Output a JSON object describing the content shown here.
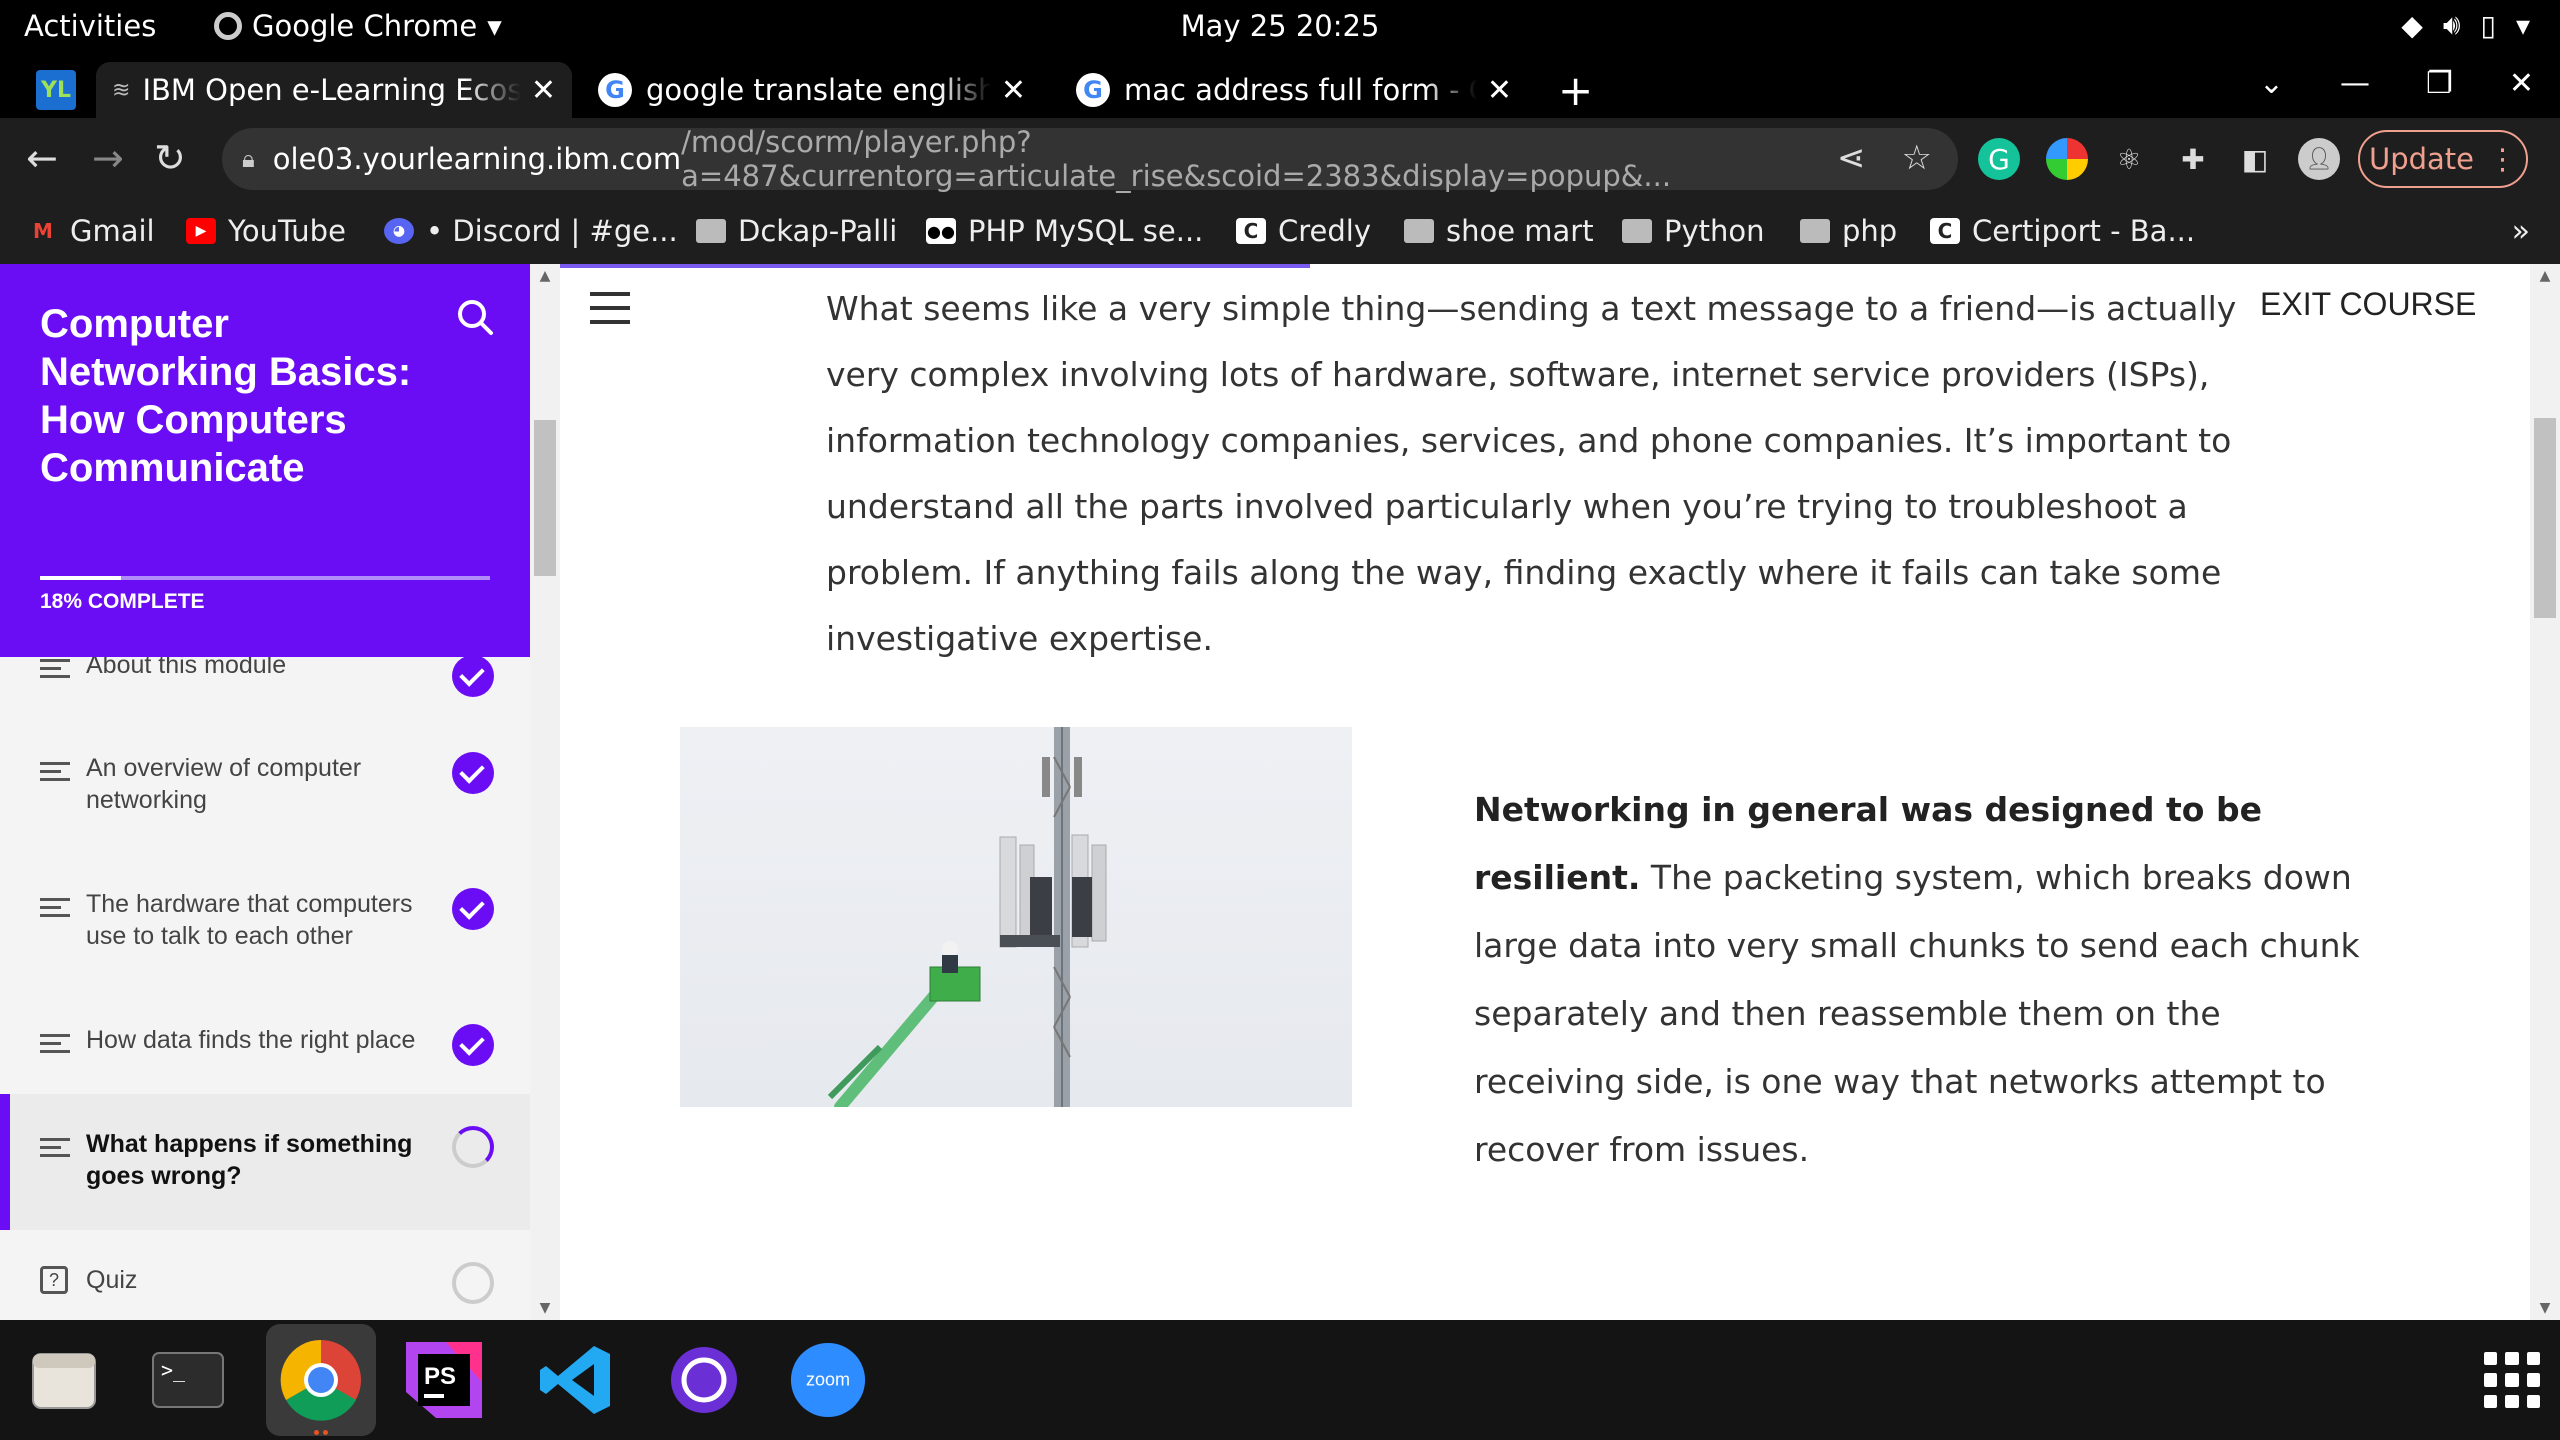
{
  "system": {
    "activities": "Activities",
    "app_name": "Google Chrome",
    "clock": "May 25  20:25"
  },
  "tabs": [
    {
      "title": "IBM Open e-Learning Ecosystem",
      "active": true
    },
    {
      "title": "google translate english to",
      "active": false
    },
    {
      "title": "mac address full form - Google",
      "active": false
    }
  ],
  "address_bar": {
    "host": "ole03.yourlearning.ibm.com",
    "path": "/mod/scorm/player.php?a=487&currentorg=articulate_rise&scoid=2383&display=popup&..."
  },
  "update_button": "Update",
  "bookmarks": [
    {
      "label": "Gmail",
      "icon": "gmail-icon"
    },
    {
      "label": "YouTube",
      "icon": "youtube-icon"
    },
    {
      "label": "• Discord | #ge...",
      "icon": "discord-icon"
    },
    {
      "label": "Dckap-Palli",
      "icon": "folder-icon"
    },
    {
      "label": "PHP MySQL se...",
      "icon": "medium-icon"
    },
    {
      "label": "Credly",
      "icon": "credly-icon"
    },
    {
      "label": "shoe mart",
      "icon": "folder-icon"
    },
    {
      "label": "Python",
      "icon": "folder-icon"
    },
    {
      "label": "php",
      "icon": "folder-icon"
    },
    {
      "label": "Certiport - Ba...",
      "icon": "certiport-icon"
    }
  ],
  "bookmarks_more": "»",
  "course": {
    "title": "Computer Networking Basics: How Computers Communicate",
    "progress_label": "18% COMPLETE",
    "progress_fraction": 0.18,
    "lessons": [
      {
        "label": "About this module",
        "status": "done"
      },
      {
        "label": "An overview of computer networking",
        "status": "done"
      },
      {
        "label": "The hardware that computers use to talk to each other",
        "status": "done"
      },
      {
        "label": "How data finds the right place",
        "status": "done"
      },
      {
        "label": "What happens if something goes wrong?",
        "status": "in-progress"
      },
      {
        "label": "Quiz",
        "status": "not-started"
      }
    ]
  },
  "exit_label": "EXIT COURSE",
  "content": {
    "intro": "What seems like a very simple thing—sending a text message to a friend—is actually very complex involving lots of hardware, software, internet service providers (ISPs), information technology companies, services, and phone companies. It’s important to understand all the parts involved particularly when you’re trying to troubleshoot a problem. If anything fails along the way, finding exactly where it fails can take some investigative expertise.",
    "resilience_bold": "Networking in general was designed to be resilient.",
    "resilience_rest": " The packeting system, which breaks down large data into very small chunks to send each chunk separately and then reassemble them on the receiving side, is one way that networks attempt to recover from issues."
  },
  "dock": {
    "apps": [
      "files",
      "terminal",
      "chrome",
      "phpstorm",
      "vscode",
      "screen-recorder",
      "zoom"
    ],
    "zoom_label": "zoom",
    "phpstorm_label": "PS"
  },
  "colors": {
    "accent": "#6b0df4",
    "dark_chrome": "#1e1e1e",
    "update_color": "#f0a08f"
  }
}
